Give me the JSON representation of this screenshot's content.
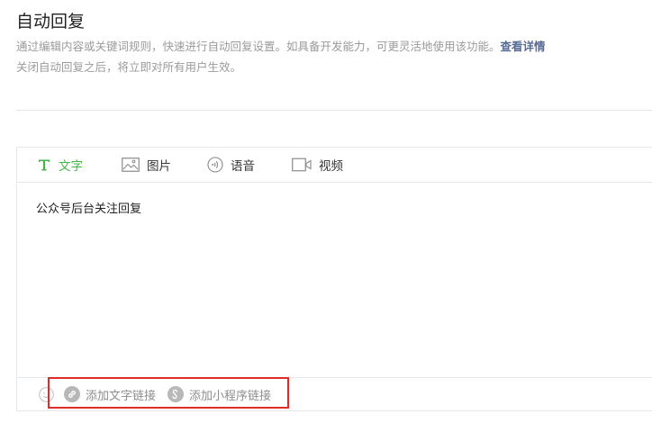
{
  "header": {
    "title": "自动回复",
    "description_line1": "通过编辑内容或关键词规则，快速进行自动回复设置。如具备开发能力，可更灵活地使用该功能。",
    "detail_link": "查看详情",
    "description_line2": "关闭自动回复之后，将立即对所有用户生效。"
  },
  "editor": {
    "tabs": [
      {
        "label": "文字",
        "icon": "text-icon",
        "active": true
      },
      {
        "label": "图片",
        "icon": "image-icon",
        "active": false
      },
      {
        "label": "语音",
        "icon": "voice-icon",
        "active": false
      },
      {
        "label": "视频",
        "icon": "video-icon",
        "active": false
      }
    ],
    "content": "公众号后台关注回复",
    "toolbar": {
      "emoji_icon": "emoji-icon",
      "add_text_link": "添加文字链接",
      "add_miniprogram_link": "添加小程序链接"
    }
  },
  "colors": {
    "accent_green": "#44b549",
    "link_blue": "#576b95",
    "highlight_red": "#e02b2b"
  }
}
